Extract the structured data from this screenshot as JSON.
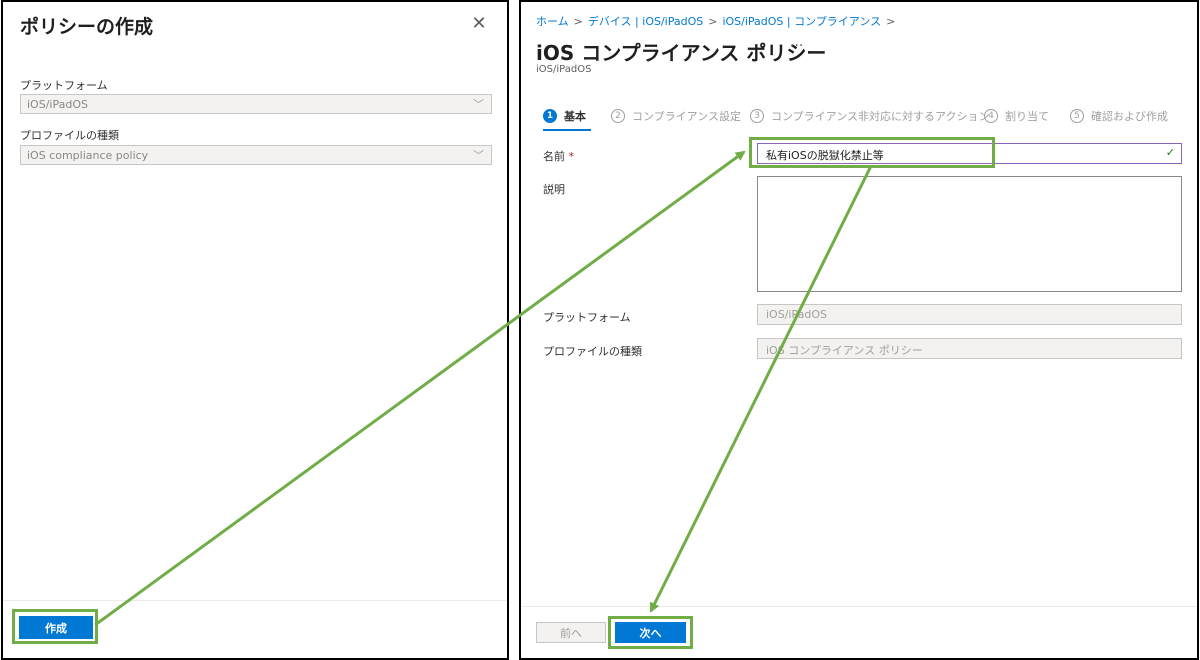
{
  "left": {
    "title": "ポリシーの作成",
    "close_icon": "close-icon",
    "platform_label": "プラットフォーム",
    "platform_value": "iOS/iPadOS",
    "profile_label": "プロファイルの種類",
    "profile_value": "iOS compliance policy",
    "create_button": "作成"
  },
  "right": {
    "breadcrumb": [
      "ホーム",
      "デバイス | iOS/iPadOS",
      "iOS/iPadOS | コンプライアンス"
    ],
    "title": "iOS コンプライアンス ポリシー",
    "more": "···",
    "subtitle": "iOS/iPadOS",
    "steps": [
      {
        "num": "1",
        "label": "基本"
      },
      {
        "num": "2",
        "label": "コンプライアンス設定"
      },
      {
        "num": "3",
        "label": "コンプライアンス非対応に対するアクション"
      },
      {
        "num": "4",
        "label": "割り当て"
      },
      {
        "num": "5",
        "label": "確認および作成"
      }
    ],
    "name_label": "名前",
    "required_mark": "*",
    "name_value": "私有iOSの脱獄化禁止等",
    "description_label": "説明",
    "platform_label": "プラットフォーム",
    "platform_value": "iOS/iPadOS",
    "profile_label": "プロファイルの種類",
    "profile_value": "iOS コンプライアンス ポリシー",
    "prev_button": "前へ",
    "next_button": "次へ"
  },
  "colors": {
    "accent": "#0078d4",
    "highlight": "#70ad47"
  }
}
